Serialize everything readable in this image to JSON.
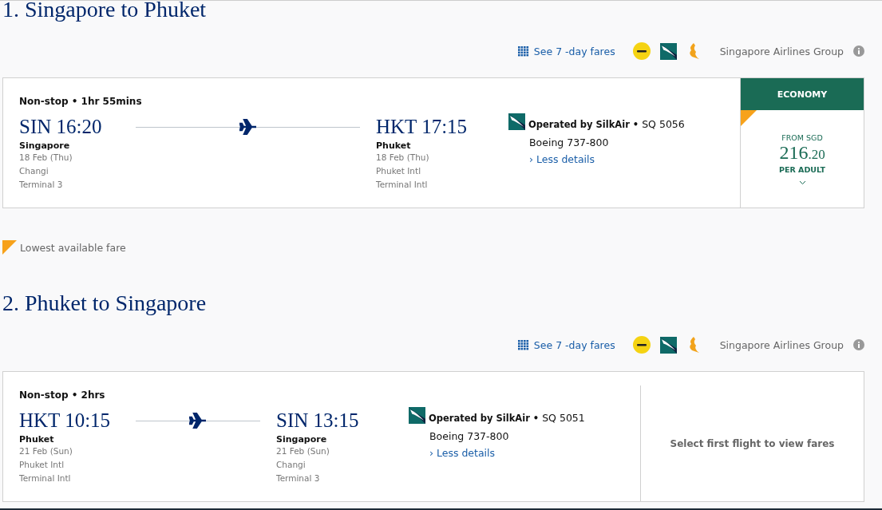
{
  "sections": [
    {
      "title": "1. Singapore to Phuket",
      "fares_link": "See 7 -day fares",
      "airline_group": "Singapore Airlines Group",
      "flight": {
        "summary": "Non-stop • 1hr 55mins",
        "depart": {
          "code_time": "SIN 16:20",
          "city": "Singapore",
          "date": "18 Feb (Thu)",
          "airport": "Changi",
          "terminal": "Terminal 3"
        },
        "arrive": {
          "code_time": "HKT 17:15",
          "city": "Phuket",
          "date": "18 Feb (Thu)",
          "airport": "Phuket Intl",
          "terminal": "Terminal Intl"
        },
        "operated_by": "Operated by SilkAir •",
        "flight_no": "SQ 5056",
        "aircraft": "Boeing 737-800",
        "details_link": "› Less details"
      },
      "fare_panel": {
        "kind": "fare",
        "cabin": "ECONOMY",
        "lowest": true,
        "from": "FROM SGD",
        "price": "216",
        "price_decimal": ".20",
        "per": "PER ADULT"
      }
    },
    {
      "title": "2. Phuket to Singapore",
      "fares_link": "See 7 -day fares",
      "airline_group": "Singapore Airlines Group",
      "flight": {
        "summary": "Non-stop • 2hrs",
        "depart": {
          "code_time": "HKT 10:15",
          "city": "Phuket",
          "date": "21 Feb (Sun)",
          "airport": "Phuket Intl",
          "terminal": "Terminal Intl"
        },
        "arrive": {
          "code_time": "SIN 13:15",
          "city": "Singapore",
          "date": "21 Feb (Sun)",
          "airport": "Changi",
          "terminal": "Terminal 3"
        },
        "operated_by": "Operated by SilkAir •",
        "flight_no": "SQ 5051",
        "aircraft": "Boeing 737-800",
        "details_link": "› Less details"
      },
      "fare_panel": {
        "kind": "message",
        "message": "Select first flight to view fares"
      }
    }
  ],
  "legend": {
    "label": "Lowest available fare"
  }
}
